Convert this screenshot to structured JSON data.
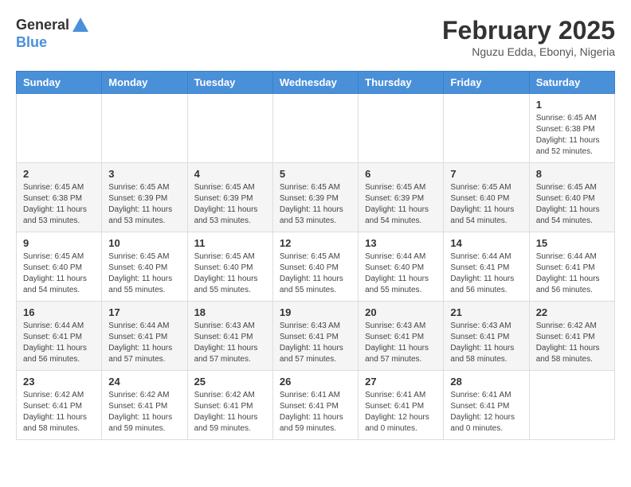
{
  "header": {
    "logo_general": "General",
    "logo_blue": "Blue",
    "month": "February 2025",
    "location": "Nguzu Edda, Ebonyi, Nigeria"
  },
  "days_of_week": [
    "Sunday",
    "Monday",
    "Tuesday",
    "Wednesday",
    "Thursday",
    "Friday",
    "Saturday"
  ],
  "weeks": [
    [
      {
        "day": "",
        "info": ""
      },
      {
        "day": "",
        "info": ""
      },
      {
        "day": "",
        "info": ""
      },
      {
        "day": "",
        "info": ""
      },
      {
        "day": "",
        "info": ""
      },
      {
        "day": "",
        "info": ""
      },
      {
        "day": "1",
        "info": "Sunrise: 6:45 AM\nSunset: 6:38 PM\nDaylight: 11 hours and 52 minutes."
      }
    ],
    [
      {
        "day": "2",
        "info": "Sunrise: 6:45 AM\nSunset: 6:38 PM\nDaylight: 11 hours and 53 minutes."
      },
      {
        "day": "3",
        "info": "Sunrise: 6:45 AM\nSunset: 6:39 PM\nDaylight: 11 hours and 53 minutes."
      },
      {
        "day": "4",
        "info": "Sunrise: 6:45 AM\nSunset: 6:39 PM\nDaylight: 11 hours and 53 minutes."
      },
      {
        "day": "5",
        "info": "Sunrise: 6:45 AM\nSunset: 6:39 PM\nDaylight: 11 hours and 53 minutes."
      },
      {
        "day": "6",
        "info": "Sunrise: 6:45 AM\nSunset: 6:39 PM\nDaylight: 11 hours and 54 minutes."
      },
      {
        "day": "7",
        "info": "Sunrise: 6:45 AM\nSunset: 6:40 PM\nDaylight: 11 hours and 54 minutes."
      },
      {
        "day": "8",
        "info": "Sunrise: 6:45 AM\nSunset: 6:40 PM\nDaylight: 11 hours and 54 minutes."
      }
    ],
    [
      {
        "day": "9",
        "info": "Sunrise: 6:45 AM\nSunset: 6:40 PM\nDaylight: 11 hours and 54 minutes."
      },
      {
        "day": "10",
        "info": "Sunrise: 6:45 AM\nSunset: 6:40 PM\nDaylight: 11 hours and 55 minutes."
      },
      {
        "day": "11",
        "info": "Sunrise: 6:45 AM\nSunset: 6:40 PM\nDaylight: 11 hours and 55 minutes."
      },
      {
        "day": "12",
        "info": "Sunrise: 6:45 AM\nSunset: 6:40 PM\nDaylight: 11 hours and 55 minutes."
      },
      {
        "day": "13",
        "info": "Sunrise: 6:44 AM\nSunset: 6:40 PM\nDaylight: 11 hours and 55 minutes."
      },
      {
        "day": "14",
        "info": "Sunrise: 6:44 AM\nSunset: 6:41 PM\nDaylight: 11 hours and 56 minutes."
      },
      {
        "day": "15",
        "info": "Sunrise: 6:44 AM\nSunset: 6:41 PM\nDaylight: 11 hours and 56 minutes."
      }
    ],
    [
      {
        "day": "16",
        "info": "Sunrise: 6:44 AM\nSunset: 6:41 PM\nDaylight: 11 hours and 56 minutes."
      },
      {
        "day": "17",
        "info": "Sunrise: 6:44 AM\nSunset: 6:41 PM\nDaylight: 11 hours and 57 minutes."
      },
      {
        "day": "18",
        "info": "Sunrise: 6:43 AM\nSunset: 6:41 PM\nDaylight: 11 hours and 57 minutes."
      },
      {
        "day": "19",
        "info": "Sunrise: 6:43 AM\nSunset: 6:41 PM\nDaylight: 11 hours and 57 minutes."
      },
      {
        "day": "20",
        "info": "Sunrise: 6:43 AM\nSunset: 6:41 PM\nDaylight: 11 hours and 57 minutes."
      },
      {
        "day": "21",
        "info": "Sunrise: 6:43 AM\nSunset: 6:41 PM\nDaylight: 11 hours and 58 minutes."
      },
      {
        "day": "22",
        "info": "Sunrise: 6:42 AM\nSunset: 6:41 PM\nDaylight: 11 hours and 58 minutes."
      }
    ],
    [
      {
        "day": "23",
        "info": "Sunrise: 6:42 AM\nSunset: 6:41 PM\nDaylight: 11 hours and 58 minutes."
      },
      {
        "day": "24",
        "info": "Sunrise: 6:42 AM\nSunset: 6:41 PM\nDaylight: 11 hours and 59 minutes."
      },
      {
        "day": "25",
        "info": "Sunrise: 6:42 AM\nSunset: 6:41 PM\nDaylight: 11 hours and 59 minutes."
      },
      {
        "day": "26",
        "info": "Sunrise: 6:41 AM\nSunset: 6:41 PM\nDaylight: 11 hours and 59 minutes."
      },
      {
        "day": "27",
        "info": "Sunrise: 6:41 AM\nSunset: 6:41 PM\nDaylight: 12 hours and 0 minutes."
      },
      {
        "day": "28",
        "info": "Sunrise: 6:41 AM\nSunset: 6:41 PM\nDaylight: 12 hours and 0 minutes."
      },
      {
        "day": "",
        "info": ""
      }
    ]
  ]
}
